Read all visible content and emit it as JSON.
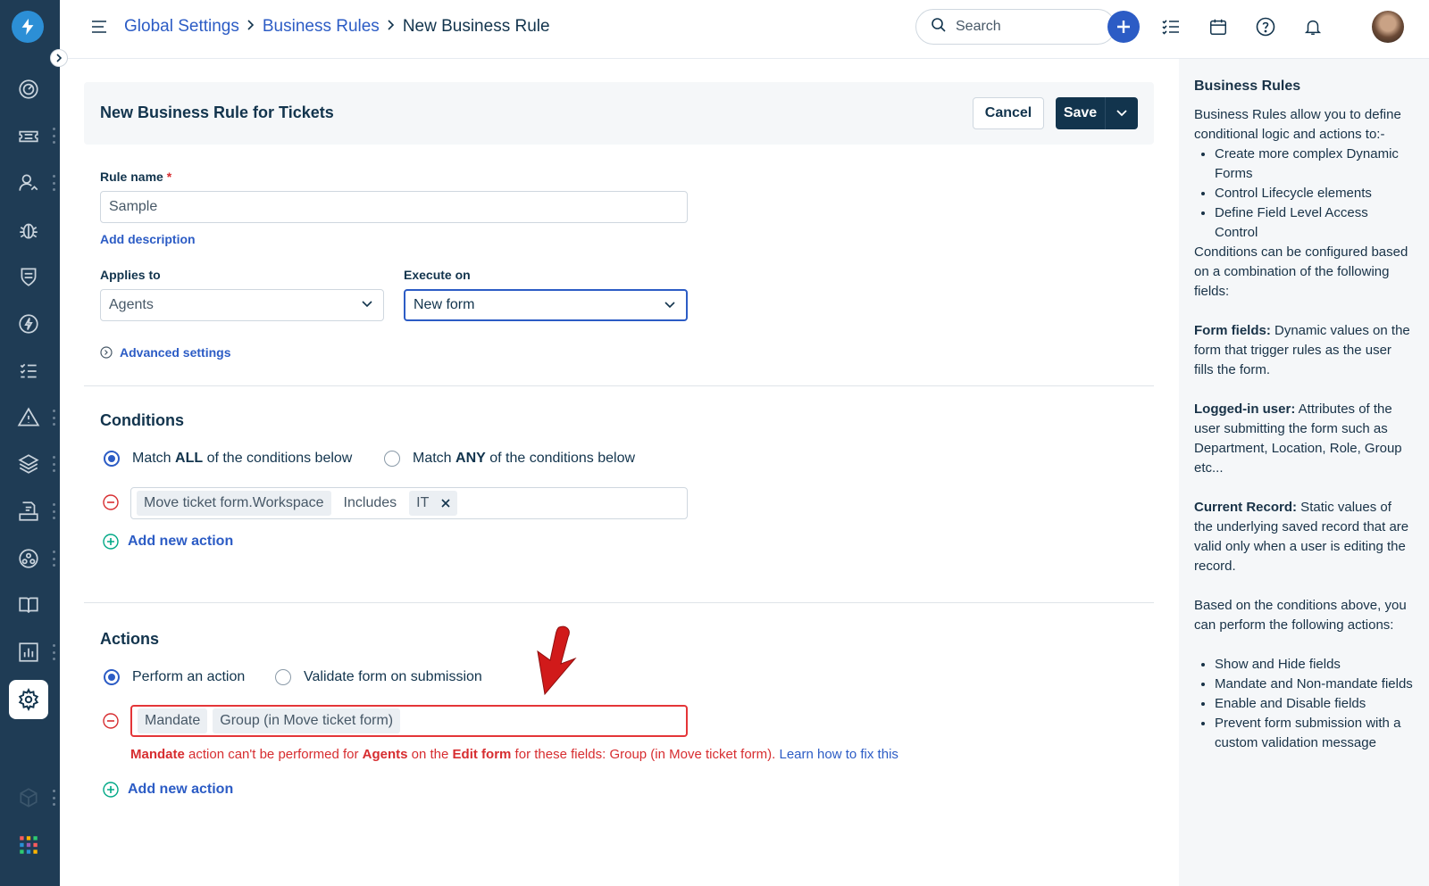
{
  "header": {
    "breadcrumb": [
      "Global Settings",
      "Business Rules"
    ],
    "current": "New Business Rule",
    "search_placeholder": "Search"
  },
  "page": {
    "title": "New Business Rule for Tickets",
    "cancel_label": "Cancel",
    "save_label": "Save"
  },
  "form": {
    "rule_name_label": "Rule name",
    "rule_name_required": "*",
    "rule_name_value": "Sample",
    "add_description": "Add description",
    "applies_to_label": "Applies to",
    "applies_to_value": "Agents",
    "execute_on_label": "Execute on",
    "execute_on_value": "New form",
    "advanced_settings": "Advanced settings"
  },
  "conditions": {
    "title": "Conditions",
    "match_all_pre": "Match ",
    "match_all_bold": "ALL",
    "match_all_post": " of the conditions below",
    "match_any_pre": "Match ",
    "match_any_bold": "ANY",
    "match_any_post": " of the conditions below",
    "rule": {
      "field": "Move ticket form.Workspace",
      "operator": "Includes",
      "value": "IT"
    },
    "add_new_action": "Add new action"
  },
  "actions": {
    "title": "Actions",
    "perform_label": "Perform an action",
    "validate_label": "Validate form on submission",
    "rule": {
      "action": "Mandate",
      "field": "Group (in Move ticket form)"
    },
    "error": {
      "mandate": "Mandate",
      "t1": " action can't be performed for ",
      "agents": "Agents",
      "t2": " on the ",
      "edit_form": "Edit form",
      "t3": " for these fields: Group (in Move ticket form). ",
      "fix_link": "Learn how to fix this"
    },
    "add_new_action": "Add new action"
  },
  "help": {
    "title": "Business Rules",
    "intro": "Business Rules allow you to define conditional logic and actions to:-",
    "intro_items": [
      "Create more complex Dynamic Forms",
      "Control Lifecycle elements",
      "Define Field Level Access Control"
    ],
    "conditions_text": "Conditions can be configured based on a combination of the following fields:",
    "form_fields_bold": "Form fields:",
    "form_fields_text": " Dynamic values on the form that trigger rules as the user fills the form.",
    "logged_in_bold": "Logged-in user:",
    "logged_in_text": " Attributes of the user submitting the form such as Department, Location, Role, Group etc...",
    "current_record_bold": "Current Record:",
    "current_record_text": " Static values of the underlying saved record that are valid only when a user is editing the record.",
    "based_on": "Based on the conditions above, you can perform the following actions:",
    "action_items": [
      "Show and Hide fields",
      "Mandate and Non-mandate fields",
      "Enable and Disable fields",
      "Prevent form submission with a custom validation message"
    ]
  },
  "colors": {
    "sidebar": "#1f3c55",
    "primary": "#2c5cc5",
    "error": "#e43538",
    "dark_button": "#12344d"
  },
  "icons": [
    "bolt-logo-icon",
    "dashboard-icon",
    "ticket-icon",
    "contacts-icon",
    "bug-icon",
    "shield-icon",
    "lightning-icon",
    "checklist-icon",
    "alert-icon",
    "layers-icon",
    "document-icon",
    "network-icon",
    "book-icon",
    "chart-icon",
    "gear-icon",
    "cube-icon",
    "apps-grid-icon"
  ]
}
